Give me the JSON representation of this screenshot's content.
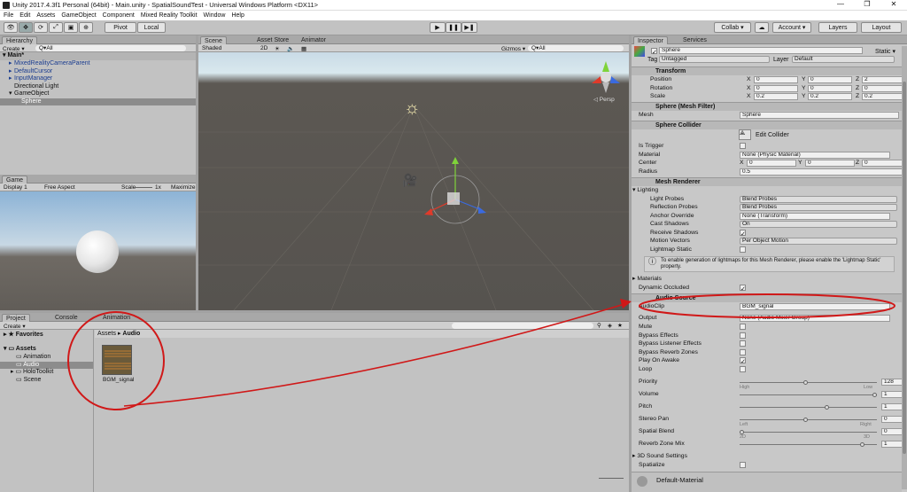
{
  "window": {
    "title": "Unity 2017.4.3f1 Personal (64bit) - Main.unity - SpatialSoundTest - Universal Windows Platform <DX11>",
    "min": "—",
    "max": "❐",
    "close": "✕"
  },
  "menu": [
    "File",
    "Edit",
    "Assets",
    "GameObject",
    "Component",
    "Mixed Reality Toolkit",
    "Window",
    "Help"
  ],
  "toolbar": {
    "pivot": "Pivot",
    "local": "Local",
    "collab": "Collab ▾",
    "account": "Account ▾",
    "layers": "Layers",
    "layout": "Layout"
  },
  "hierarchy": {
    "tab": "Hierarchy",
    "create": "Create ▾",
    "search": "Q▾All",
    "scene": "Main*",
    "items": [
      "MixedRealityCameraParent",
      "DefaultCursor",
      "InputManager",
      "Directional Light",
      "GameObject",
      "Sphere"
    ]
  },
  "scene": {
    "tabs": [
      "Scene",
      "Asset Store",
      "Animator"
    ],
    "shaded": "Shaded",
    "mode2d": "2D",
    "gizmos": "Gizmos ▾",
    "search": "Q▾All",
    "persp": "◁ Persp"
  },
  "game": {
    "tab": "Game",
    "display": "Display 1",
    "aspect": "Free Aspect",
    "scale": "Scale",
    "scale_val": "1x",
    "maximize": "Maximize"
  },
  "project": {
    "tabs": [
      "Project",
      "Console",
      "Animation"
    ],
    "create": "Create ▾",
    "favorites": "Favorites",
    "assets": "Assets",
    "folders": [
      "Animation",
      "Audio",
      "HoloToolkit",
      "Scene"
    ],
    "breadcrumb": [
      "Assets",
      "Audio"
    ],
    "file": "BGM_signal"
  },
  "inspector": {
    "tabs": [
      "Inspector",
      "Services"
    ],
    "name": "Sphere",
    "static": "Static ▾",
    "tag_label": "Tag",
    "tag": "Untagged",
    "layer_label": "Layer",
    "layer": "Default",
    "transform": {
      "title": "Transform",
      "position": [
        "0",
        "0",
        "2"
      ],
      "rotation": [
        "0",
        "0",
        "0"
      ],
      "scale": [
        "0.2",
        "0.2",
        "0.2"
      ],
      "labels": [
        "Position",
        "Rotation",
        "Scale"
      ]
    },
    "mesh_filter": {
      "title": "Sphere (Mesh Filter)",
      "mesh_label": "Mesh",
      "mesh": "Sphere"
    },
    "collider": {
      "title": "Sphere Collider",
      "edit": "Edit Collider",
      "is_trigger": "Is Trigger",
      "material_label": "Material",
      "material": "None (Physic Material)",
      "center_label": "Center",
      "center": [
        "0",
        "0",
        "0"
      ],
      "radius_label": "Radius",
      "radius": "0.5"
    },
    "renderer": {
      "title": "Mesh Renderer",
      "lighting": "Lighting",
      "light_probes_l": "Light Probes",
      "light_probes": "Blend Probes",
      "refl_l": "Reflection Probes",
      "refl": "Blend Probes",
      "anchor_l": "Anchor Override",
      "anchor": "None (Transform)",
      "cast_l": "Cast Shadows",
      "cast": "On",
      "receive_l": "Receive Shadows",
      "motion_l": "Motion Vectors",
      "motion": "Per Object Motion",
      "static_l": "Lightmap Static",
      "info": "To enable generation of lightmaps for this Mesh Renderer, please enable the 'Lightmap Static' property.",
      "materials": "Materials",
      "occluded": "Dynamic Occluded"
    },
    "audio": {
      "title": "Audio Source",
      "clip_l": "AudioClip",
      "clip": "BGM_signal",
      "output_l": "Output",
      "output": "None (Audio Mixer Group)",
      "mute": "Mute",
      "bypass_fx": "Bypass Effects",
      "bypass_listener": "Bypass Listener Effects",
      "bypass_reverb": "Bypass Reverb Zones",
      "play_awake": "Play On Awake",
      "loop": "Loop",
      "priority_l": "Priority",
      "priority": "128",
      "high": "High",
      "low": "Low",
      "volume_l": "Volume",
      "volume": "1",
      "pitch_l": "Pitch",
      "pitch": "1",
      "pan_l": "Stereo Pan",
      "pan": "0",
      "left": "Left",
      "right": "Right",
      "blend_l": "Spatial Blend",
      "blend": "0",
      "d2": "2D",
      "d3": "3D",
      "reverb_l": "Reverb Zone Mix",
      "reverb": "1",
      "sound3d": "3D Sound Settings",
      "spatialize": "Spatialize"
    },
    "material_footer": "Default-Material"
  }
}
